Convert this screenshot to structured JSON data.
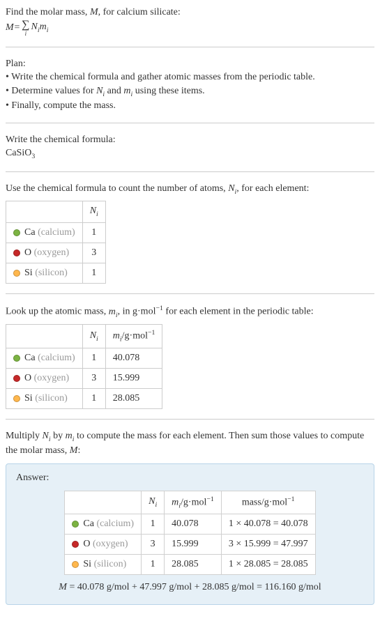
{
  "intro": {
    "line1_pre": "Find the molar mass, ",
    "line1_var": "M",
    "line1_post": ", for calcium silicate:",
    "eq_lhs": "M",
    "eq_eq": " = ",
    "eq_term1": "N",
    "eq_term1_sub": "i",
    "eq_term2": "m",
    "eq_term2_sub": "i",
    "sigma_sub": "i"
  },
  "plan": {
    "heading": "Plan:",
    "b1": "• Write the chemical formula and gather atomic masses from the periodic table.",
    "b2_pre": "• Determine values for ",
    "b2_n": "N",
    "b2_nsub": "i",
    "b2_mid": " and ",
    "b2_m": "m",
    "b2_msub": "i",
    "b2_post": " using these items.",
    "b3": "• Finally, compute the mass."
  },
  "chem": {
    "heading": "Write the chemical formula:",
    "formula_pre": "CaSiO",
    "formula_sub": "3"
  },
  "count": {
    "text_pre": "Use the chemical formula to count the number of atoms, ",
    "text_n": "N",
    "text_nsub": "i",
    "text_post": ", for each element:",
    "hdr_n": "N",
    "hdr_nsub": "i",
    "ca_sym": "Ca",
    "ca_name": "(calcium)",
    "ca_n": "1",
    "o_sym": "O",
    "o_name": "(oxygen)",
    "o_n": "3",
    "si_sym": "Si",
    "si_name": "(silicon)",
    "si_n": "1"
  },
  "mass": {
    "text_pre": "Look up the atomic mass, ",
    "text_m": "m",
    "text_msub": "i",
    "text_mid": ", in g·mol",
    "text_exp": "−1",
    "text_post": " for each element in the periodic table:",
    "hdr_n": "N",
    "hdr_nsub": "i",
    "hdr_m": "m",
    "hdr_msub": "i",
    "hdr_unit": "/g·mol",
    "hdr_exp": "−1",
    "ca_n": "1",
    "ca_m": "40.078",
    "o_n": "3",
    "o_m": "15.999",
    "si_n": "1",
    "si_m": "28.085"
  },
  "compute": {
    "text_pre": "Multiply ",
    "text_n": "N",
    "text_nsub": "i",
    "text_mid1": " by ",
    "text_m": "m",
    "text_msub": "i",
    "text_mid2": " to compute the mass for each element. Then sum those values to compute the molar mass, ",
    "text_M": "M",
    "text_post": ":"
  },
  "answer": {
    "title": "Answer:",
    "hdr_n": "N",
    "hdr_nsub": "i",
    "hdr_m": "m",
    "hdr_msub": "i",
    "hdr_unit": "/g·mol",
    "hdr_exp": "−1",
    "hdr_mass": "mass/g·mol",
    "hdr_mass_exp": "−1",
    "ca_n": "1",
    "ca_m": "40.078",
    "ca_calc": "1 × 40.078 = 40.078",
    "o_n": "3",
    "o_m": "15.999",
    "o_calc": "3 × 15.999 = 47.997",
    "si_n": "1",
    "si_m": "28.085",
    "si_calc": "1 × 28.085 = 28.085",
    "final_lhs": "M",
    "final_rhs": " = 40.078 g/mol + 47.997 g/mol + 28.085 g/mol = 116.160 g/mol"
  }
}
